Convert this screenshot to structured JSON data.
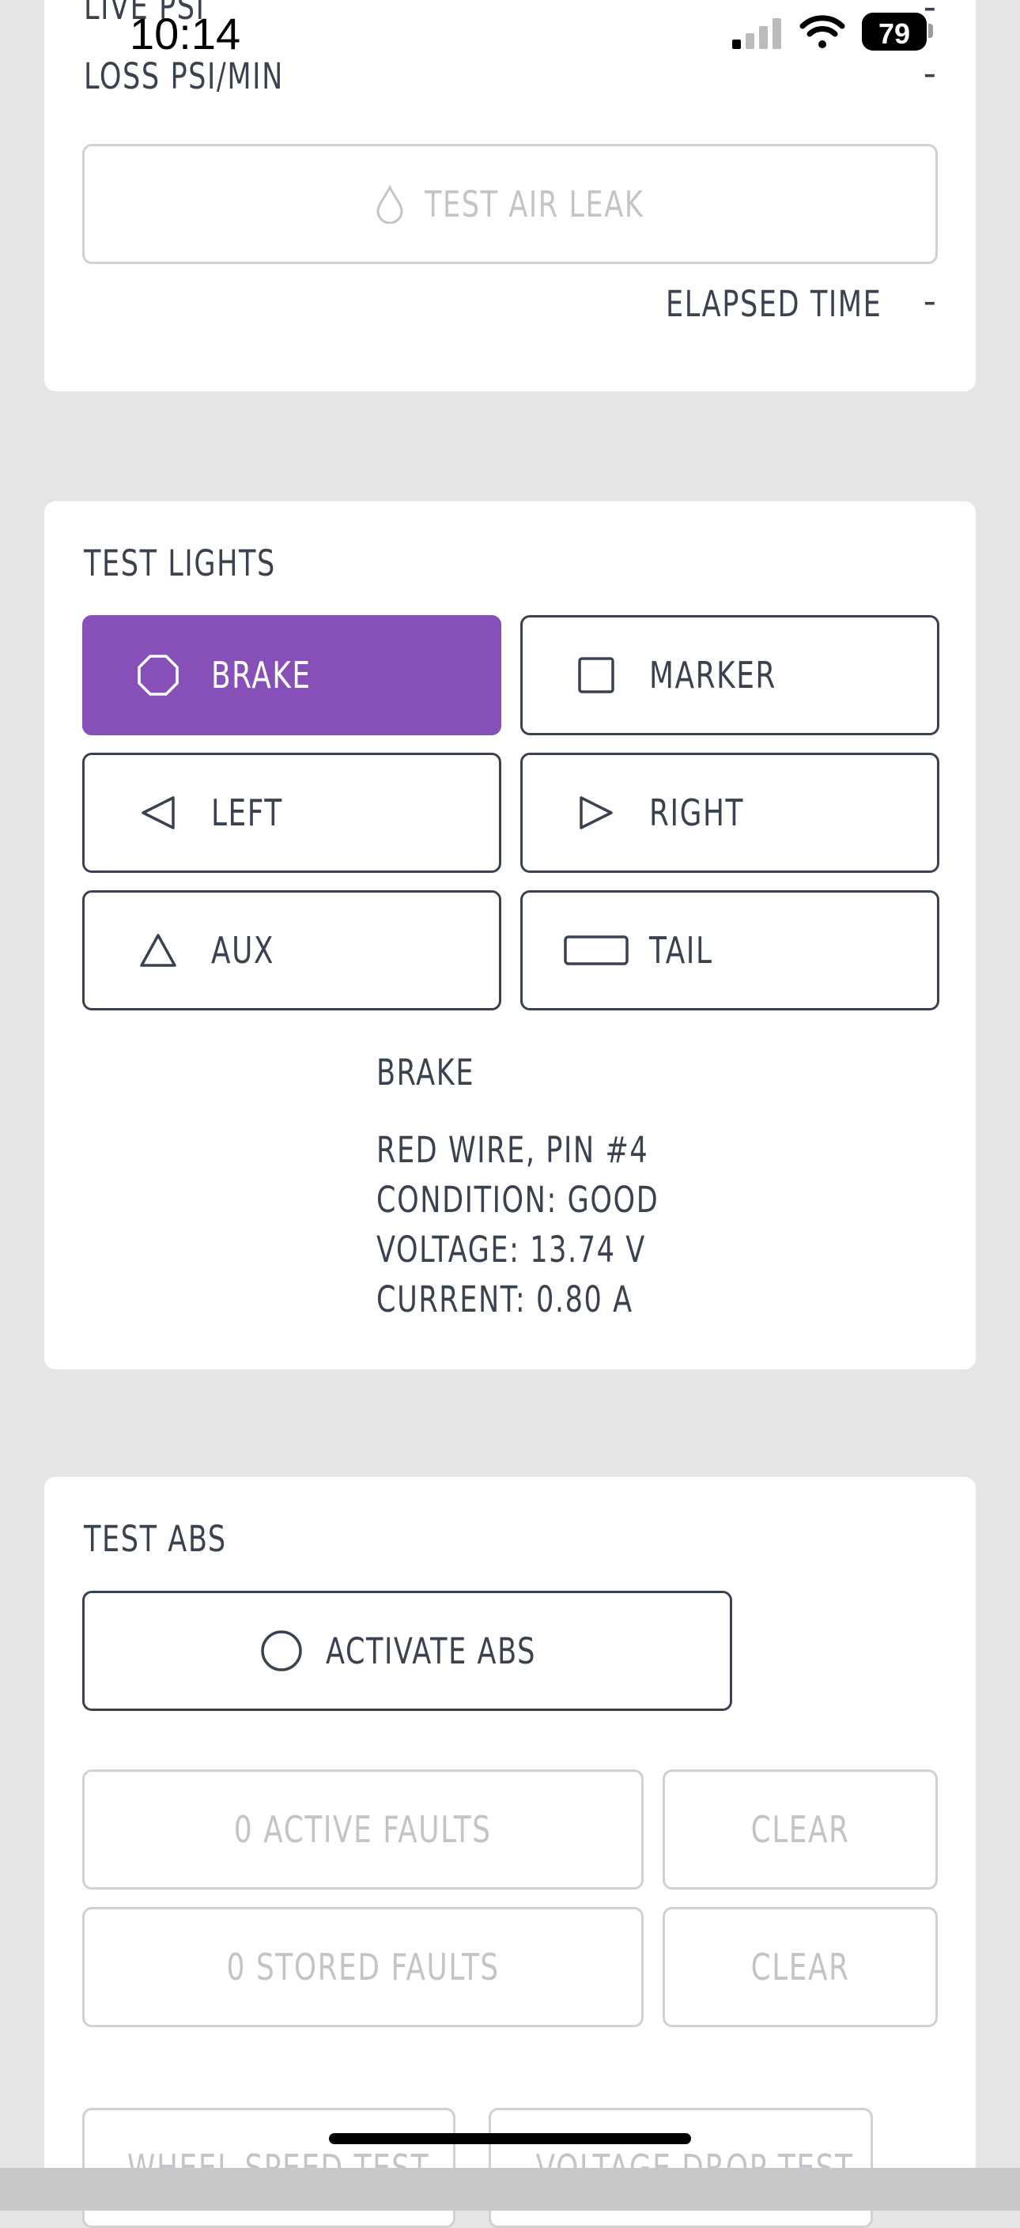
{
  "status_bar": {
    "time": "10:14",
    "battery": "79"
  },
  "air_leak": {
    "live_psi_label": "LIVE PSI",
    "live_psi_value": "-",
    "loss_label": "LOSS PSI/MIN",
    "loss_value": "-",
    "test_button": "TEST AIR LEAK",
    "elapsed_label": "ELAPSED TIME",
    "elapsed_value": "-"
  },
  "test_lights": {
    "title": "TEST LIGHTS",
    "buttons": [
      {
        "label": "BRAKE",
        "icon": "octagon-icon",
        "active": true
      },
      {
        "label": "MARKER",
        "icon": "square-icon",
        "active": false
      },
      {
        "label": "LEFT",
        "icon": "triangle-left-icon",
        "active": false
      },
      {
        "label": "RIGHT",
        "icon": "triangle-right-icon",
        "active": false
      },
      {
        "label": "AUX",
        "icon": "triangle-up-icon",
        "active": false
      },
      {
        "label": "TAIL",
        "icon": "rectangle-icon",
        "active": false
      }
    ],
    "detail": {
      "name": "BRAKE",
      "lines": [
        "RED WIRE, PIN #4",
        "CONDITION: GOOD",
        "VOLTAGE: 13.74 V",
        "CURRENT: 0.80 A"
      ]
    }
  },
  "test_abs": {
    "title": "TEST ABS",
    "activate_button": "ACTIVATE ABS",
    "active_faults": "0 ACTIVE FAULTS",
    "stored_faults": "0 STORED FAULTS",
    "clear_label": "CLEAR",
    "wheel_speed_test": "WHEEL SPEED TEST",
    "voltage_drop_test": "VOLTAGE DROP TEST"
  },
  "colors": {
    "accent": "#8750b8",
    "text": "#3a4250",
    "disabled": "#c2c4c7",
    "background": "#e4e5e5"
  }
}
